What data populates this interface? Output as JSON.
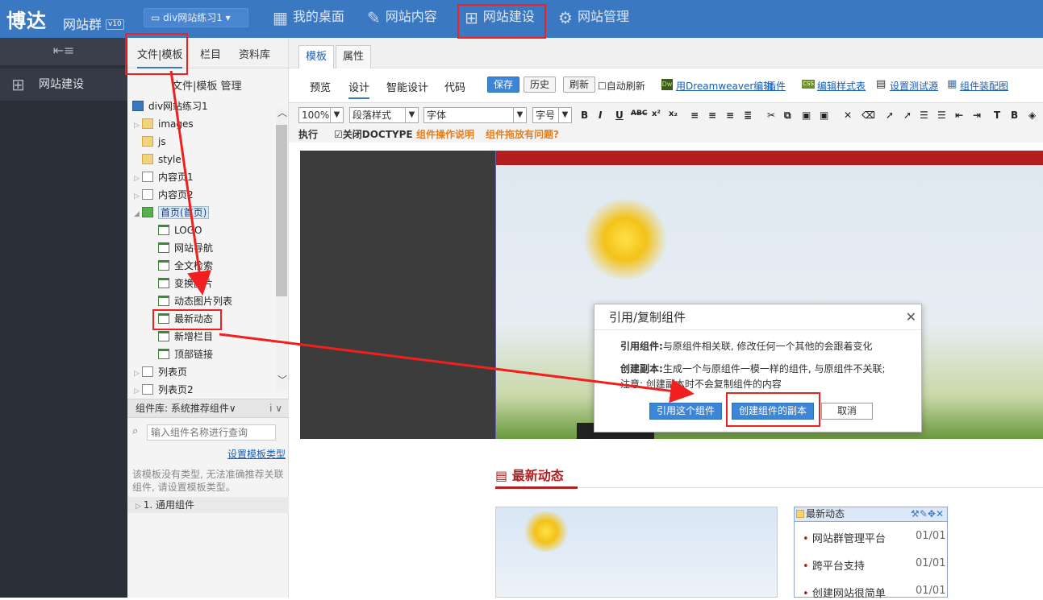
{
  "app": {
    "logo": "博达",
    "logo_sub": "网站群",
    "version": "v10",
    "site_select": "div网站练习1 ▾"
  },
  "topnav": {
    "items": [
      {
        "label": "我的桌面",
        "icon": "desktop-icon"
      },
      {
        "label": "网站内容",
        "icon": "edit-icon"
      },
      {
        "label": "网站建设",
        "icon": "build-icon"
      },
      {
        "label": "网站管理",
        "icon": "manage-icon"
      }
    ]
  },
  "leftnav": {
    "menu_icon": "⇤≡",
    "item": "网站建设"
  },
  "panel": {
    "tabs": [
      "文件|模板",
      "栏目",
      "资料库"
    ],
    "subtitle": "文件|模板 管理",
    "tree": [
      {
        "label": "div网站练习1"
      },
      {
        "label": "images"
      },
      {
        "label": "js"
      },
      {
        "label": "style"
      },
      {
        "label": "内容页1"
      },
      {
        "label": "内容页2"
      },
      {
        "label": "首页(首页)"
      },
      {
        "label": "LOGO"
      },
      {
        "label": "网站导航"
      },
      {
        "label": "全文检索"
      },
      {
        "label": "变换图片"
      },
      {
        "label": "动态图片列表"
      },
      {
        "label": "最新动态"
      },
      {
        "label": "新增栏目"
      },
      {
        "label": "顶部链接"
      },
      {
        "label": "列表页"
      },
      {
        "label": "列表页2"
      }
    ],
    "comp_lib": "组件库: 系统推荐组件∨",
    "comp_lib_info": "i ∨",
    "search_placeholder": "输入组件名称进行查询",
    "set_type": "设置模板类型",
    "tip": "该模板没有类型, 无法准确推荐关联组件, 请设置模板类型。",
    "general": "1. 通用组件"
  },
  "editor": {
    "tabs": [
      "模板",
      "属性"
    ],
    "modes": [
      "预览",
      "设计",
      "智能设计",
      "代码"
    ],
    "save": "保存",
    "history": "历史",
    "refresh": "刷新",
    "auto_refresh": "自动刷新",
    "dreamweaver": "用Dreamweaver编辑",
    "plugin": "插件",
    "edit_style": "编辑样式表",
    "set_source": "设置测试源",
    "comp_map": "组件装配图",
    "zoom": "100%",
    "para_style": "段落样式",
    "font": "字体",
    "font_size": "字号",
    "execute": "执行",
    "close_doctype": "关闭DOCTYPE",
    "comp_help": "组件操作说明",
    "comp_issue": "组件拖放有问题?"
  },
  "canvas": {
    "news_title": "最新动态",
    "box_title": "最新动态",
    "news": [
      {
        "title": "网站群管理平台",
        "date": "01/01"
      },
      {
        "title": "跨平台支持",
        "date": "01/01"
      },
      {
        "title": "创建网站很简单",
        "date": "01/01"
      }
    ]
  },
  "dialog": {
    "title": "引用/复制组件",
    "ref_label": "引用组件:",
    "ref_text": "与原组件相关联, 修改任何一个其他的会跟着变化",
    "copy_label": "创建副本:",
    "copy_text": "生成一个与原组件一模一样的组件, 与原组件不关联;",
    "copy_note": "注意: 创建副本时不会复制组件的内容",
    "btn_ref": "引用这个组件",
    "btn_copy": "创建组件的副本",
    "btn_cancel": "取消"
  }
}
